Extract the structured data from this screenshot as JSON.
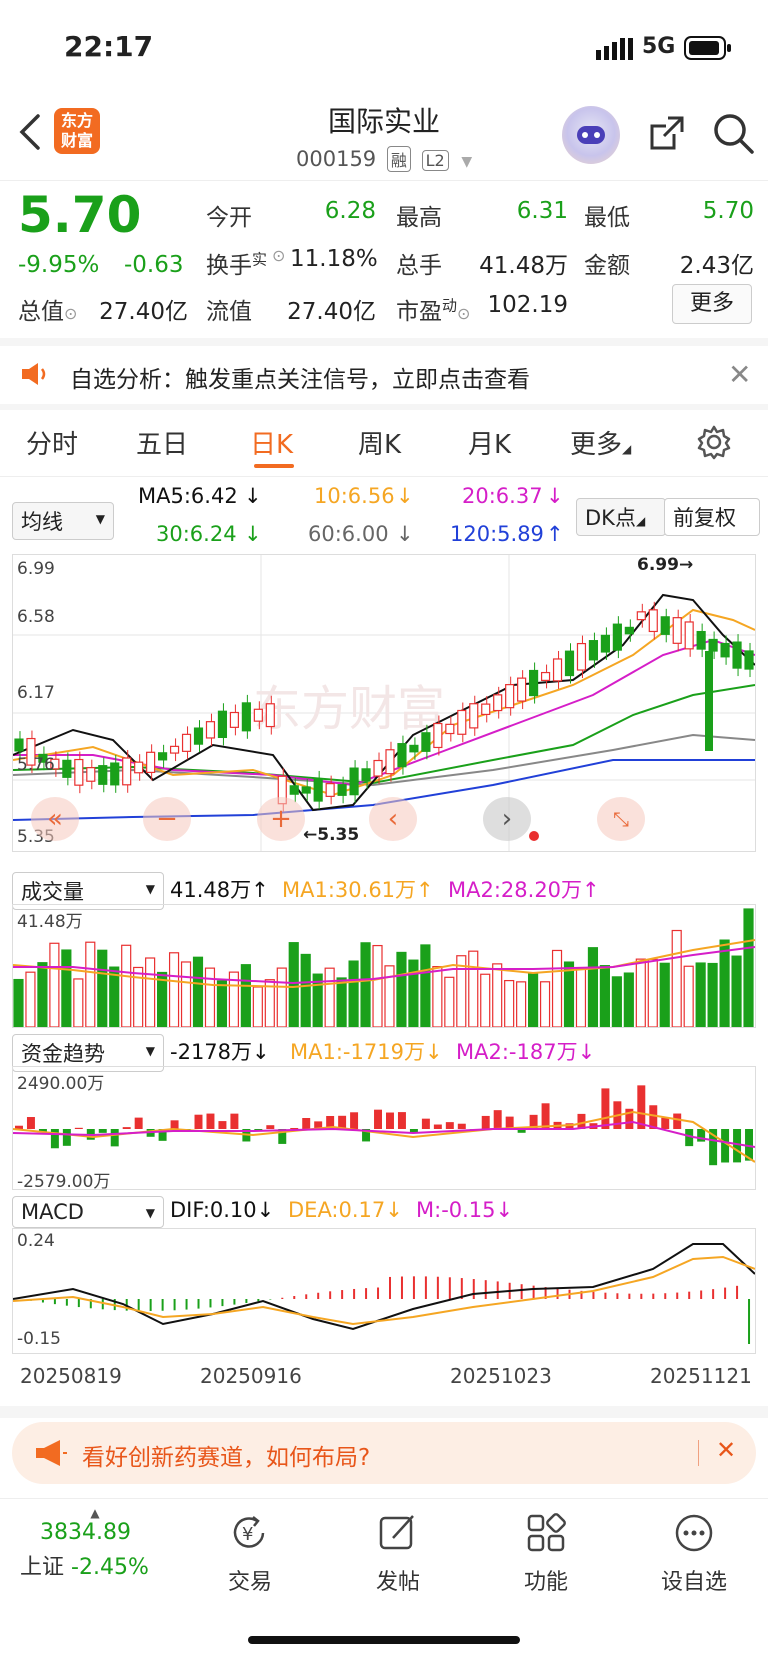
{
  "status_bar": {
    "time": "22:17",
    "network": "5G"
  },
  "header": {
    "app_logo_line1": "东方",
    "app_logo_line2": "财富",
    "title": "国际实业",
    "code": "000159",
    "tag1": "融",
    "tag2": "L2"
  },
  "quote": {
    "price": "5.70",
    "change_pct": "-9.95%",
    "change": "-0.63",
    "open_label": "今开",
    "open": "6.28",
    "high_label": "最高",
    "high": "6.31",
    "low_label": "最低",
    "low": "5.70",
    "turnover_label": "换手",
    "turnover_sup": "实",
    "turnover": "11.18%",
    "volume_label": "总手",
    "volume": "41.48万",
    "amount_label": "金额",
    "amount": "2.43亿",
    "mcap_label": "总值",
    "mcap": "27.40亿",
    "float_label": "流值",
    "float": "27.40亿",
    "pe_label": "市盈",
    "pe_sup": "动",
    "pe": "102.19",
    "more_button": "更多"
  },
  "notice": {
    "text": "自选分析：触发重点关注信号，立即点击查看"
  },
  "tabs": [
    "分时",
    "五日",
    "日K",
    "周K",
    "月K",
    "更多"
  ],
  "active_tab": "日K",
  "kline": {
    "indicator_select": "均线",
    "ma5": "MA5:6.42",
    "ma10": "10:6.56",
    "ma20": "20:6.37",
    "ma30": "30:6.24",
    "ma60": "60:6.00",
    "ma120": "120:5.89",
    "dk_button": "DK点",
    "adjust_button": "前复权",
    "y_top": "6.99",
    "y_2": "6.58",
    "y_3": "6.17",
    "y_4": "5.76",
    "y_bottom": "5.35",
    "high_marker": "6.99",
    "low_marker": "5.35",
    "watermark": "东方财富"
  },
  "volume": {
    "select": "成交量",
    "value": "41.48万",
    "ma1": "MA1:30.61万",
    "ma2": "MA2:28.20万",
    "y_top": "41.48万"
  },
  "fund_flow": {
    "select": "资金趋势",
    "value": "-2178万",
    "ma1": "MA1:-1719万",
    "ma2": "MA2:-187万",
    "y_top": "2490.00万",
    "y_bottom": "-2579.00万"
  },
  "macd": {
    "select": "MACD",
    "dif": "DIF:0.10",
    "dea": "DEA:0.17",
    "m": "M:-0.15",
    "y_top": "0.24",
    "y_bottom": "-0.15"
  },
  "dates": [
    "20250819",
    "20250916",
    "20251023",
    "20251121"
  ],
  "promo": {
    "text": "看好创新药赛道，如何布局?"
  },
  "bottom_nav": {
    "index_value": "3834.89",
    "index_name": "上证",
    "index_change": "-2.45%",
    "trade": "交易",
    "post": "发帖",
    "functions": "功能",
    "set_watch": "设自选"
  },
  "colors": {
    "up": "#e93030",
    "down": "#1aa01a",
    "accent": "#f26b21"
  }
}
